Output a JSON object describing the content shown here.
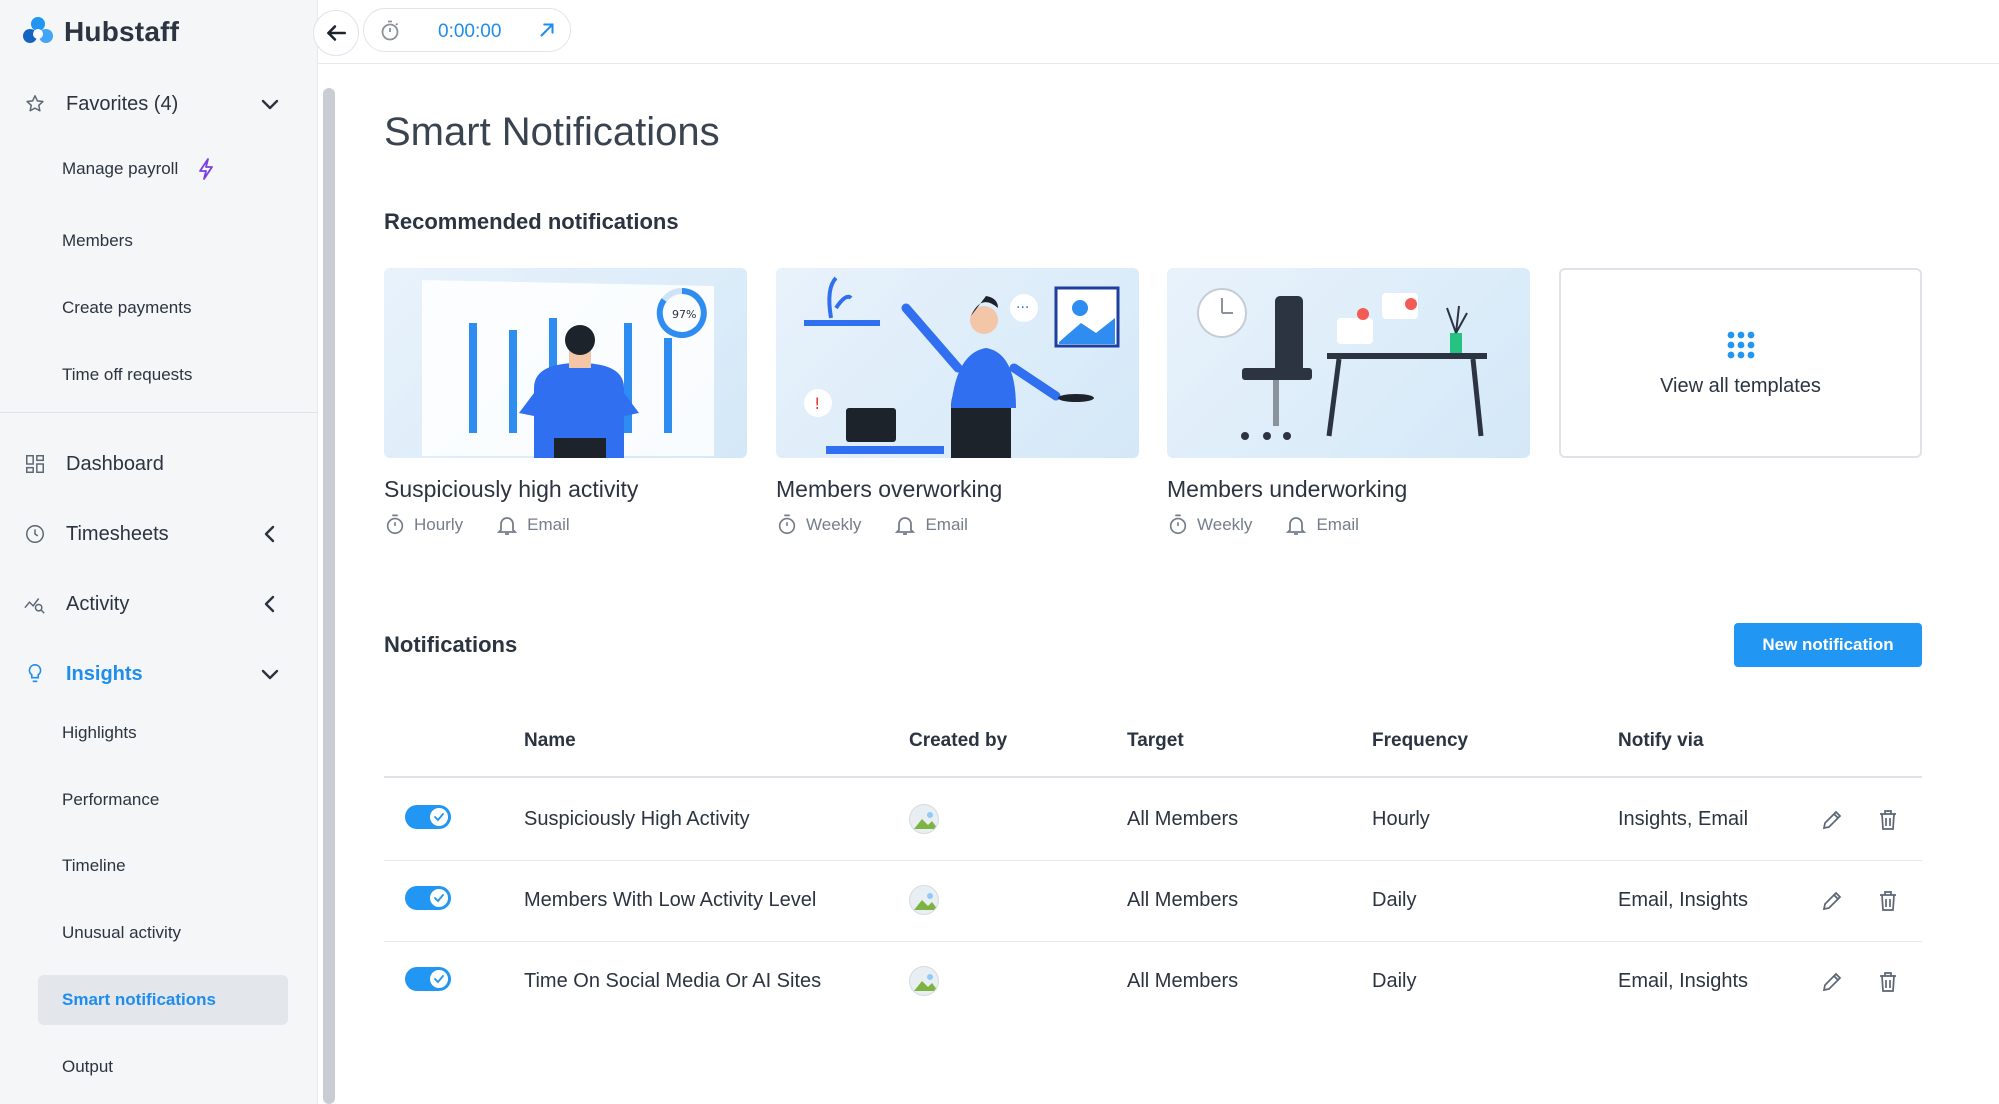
{
  "app": {
    "logo_text": "Hubstaff"
  },
  "topbar": {
    "timer_value": "0:00:00"
  },
  "sidebar": {
    "favorites": {
      "label": "Favorites (4)"
    },
    "favorite_items": [
      "Manage payroll",
      "Members",
      "Create payments",
      "Time off requests"
    ],
    "nav": {
      "dashboard": "Dashboard",
      "timesheets": "Timesheets",
      "activity": "Activity",
      "insights": "Insights"
    },
    "insights_items": [
      "Highlights",
      "Performance",
      "Timeline",
      "Unusual activity",
      "Smart notifications",
      "Output"
    ],
    "active_item": "Smart notifications"
  },
  "main": {
    "title": "Smart Notifications",
    "recommended_title": "Recommended notifications",
    "cards": [
      {
        "title": "Suspiciously high activity",
        "frequency": "Hourly",
        "channel": "Email",
        "badge": "97%"
      },
      {
        "title": "Members overworking",
        "frequency": "Weekly",
        "channel": "Email"
      },
      {
        "title": "Members underworking",
        "frequency": "Weekly",
        "channel": "Email"
      }
    ],
    "view_templates_label": "View all templates",
    "notifications_title": "Notifications",
    "new_button_label": "New notification",
    "table": {
      "headers": [
        "Name",
        "Created by",
        "Target",
        "Frequency",
        "Notify via"
      ],
      "rows": [
        {
          "enabled": true,
          "name": "Suspiciously High Activity",
          "target": "All Members",
          "frequency": "Hourly",
          "notify_via": "Insights, Email"
        },
        {
          "enabled": true,
          "name": "Members With Low Activity Level",
          "target": "All Members",
          "frequency": "Daily",
          "notify_via": "Email, Insights"
        },
        {
          "enabled": true,
          "name": "Time On Social Media Or AI Sites",
          "target": "All Members",
          "frequency": "Daily",
          "notify_via": "Email, Insights"
        }
      ]
    }
  },
  "colors": {
    "accent": "#2196f3",
    "active_text": "#1f8ded",
    "sidebar_bg": "#f4f6f8",
    "lightning": "#7b3fe4"
  }
}
